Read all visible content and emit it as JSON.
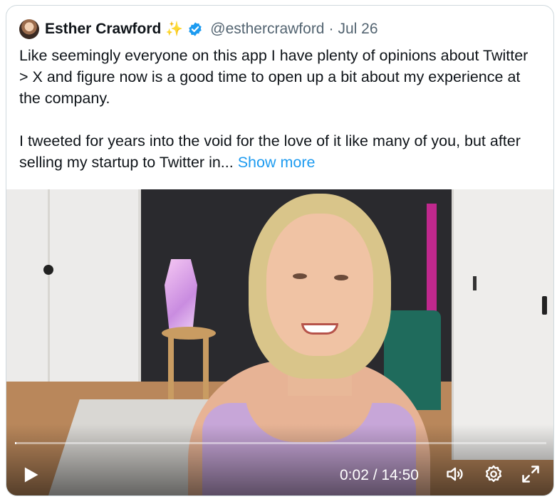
{
  "tweet": {
    "author_name": "Esther Crawford",
    "author_emoji": "✨",
    "handle": "@esthercrawford",
    "separator": "·",
    "date": "Jul 26",
    "paragraph_1": "Like seemingly everyone on this app I have plenty of opinions about Twitter > X and figure now is a good time to open up a bit about my experience at the company.",
    "paragraph_2": "I tweeted for years into the void for the love of it like many of you, but after selling my startup to Twitter in...",
    "show_more": "Show more"
  },
  "video": {
    "time": "0:02 / 14:50",
    "progress": 0.0022,
    "icons": {
      "play": "play-icon",
      "volume": "volume-icon",
      "settings": "gear-icon",
      "fullscreen": "fullscreen-icon"
    }
  },
  "colors": {
    "link": "#1d9bf0",
    "verified": "#1d9bf0",
    "secondary_text": "#536471"
  }
}
